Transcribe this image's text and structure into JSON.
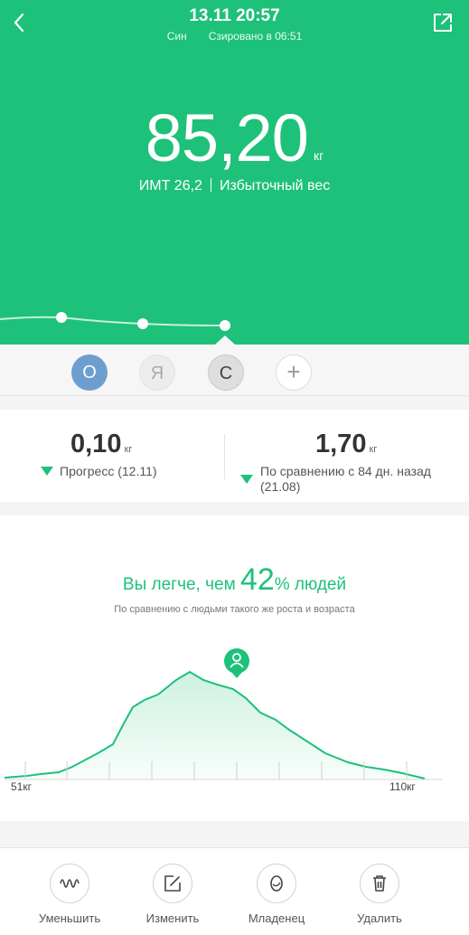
{
  "header": {
    "date_time": "13.11 20:57",
    "sync_left": "Син",
    "sync_right": "Сзировано в 06:51"
  },
  "measurement": {
    "weight": "85,20",
    "unit": "кг",
    "bmi": "ИМТ 26,2",
    "status": "Избыточный вес"
  },
  "profiles": [
    {
      "initial": "О",
      "color": "#6e9ecf",
      "selected": false
    },
    {
      "initial": "Я",
      "selected": false
    },
    {
      "initial": "С",
      "selected": true
    },
    {
      "initial": "+"
    }
  ],
  "stats": {
    "progress_value": "0,10",
    "progress_unit": "кг",
    "progress_label": "Прогресс (12.11)",
    "compare_value": "1,70",
    "compare_unit": "кг",
    "compare_label": "По сравнению с 84 дн. назад",
    "compare_date": "(21.08)"
  },
  "comparison": {
    "title_before": "Вы легче, чем ",
    "percent": "42",
    "title_after": "% людей",
    "subtitle": "По сравнению с людьми такого же роста и возраста",
    "min_label": "51кг",
    "max_label": "110кг"
  },
  "actions": [
    {
      "label": "Уменьшить",
      "icon": "wave-icon"
    },
    {
      "label": "Изменить",
      "icon": "edit-icon"
    },
    {
      "label": "Младенец",
      "icon": "baby-icon"
    },
    {
      "label": "Удалить",
      "icon": "trash-icon"
    }
  ],
  "colors": {
    "accent": "#1ec17a",
    "profile_o": "#6e9ecf"
  }
}
